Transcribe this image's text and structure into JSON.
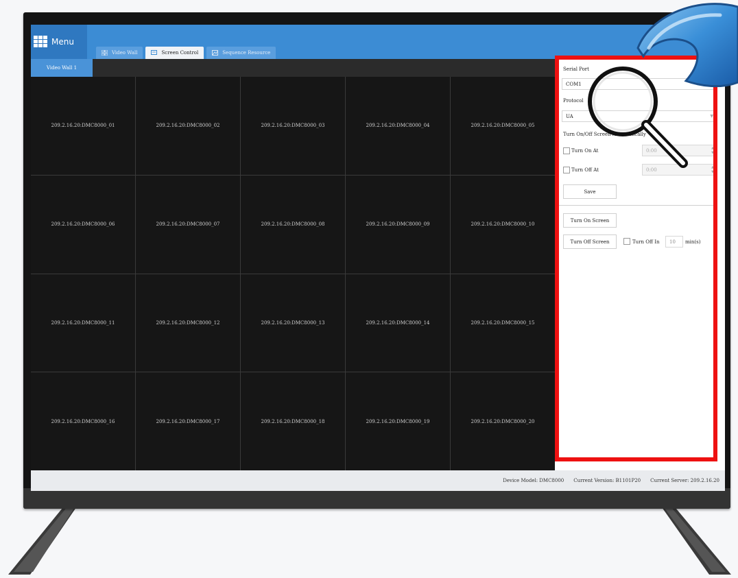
{
  "app": {
    "menu_label": "Menu",
    "tabs": [
      {
        "label": "Video Wall",
        "icon": "grid-icon",
        "active": false
      },
      {
        "label": "Screen Control",
        "icon": "screen-icon",
        "active": true
      },
      {
        "label": "Sequence Resource",
        "icon": "image-icon",
        "active": false
      }
    ],
    "subtab_label": "Video Wall 1"
  },
  "video_wall": {
    "cells": [
      "209.2.16.20:DMC8000_01",
      "209.2.16.20:DMC8000_02",
      "209.2.16.20:DMC8000_03",
      "209.2.16.20:DMC8000_04",
      "209.2.16.20:DMC8000_05",
      "209.2.16.20:DMC8000_06",
      "209.2.16.20:DMC8000_07",
      "209.2.16.20:DMC8000_08",
      "209.2.16.20:DMC8000_09",
      "209.2.16.20:DMC8000_10",
      "209.2.16.20:DMC8000_11",
      "209.2.16.20:DMC8000_12",
      "209.2.16.20:DMC8000_13",
      "209.2.16.20:DMC8000_14",
      "209.2.16.20:DMC8000_15",
      "209.2.16.20:DMC8000_16",
      "209.2.16.20:DMC8000_17",
      "209.2.16.20:DMC8000_18",
      "209.2.16.20:DMC8000_19",
      "209.2.16.20:DMC8000_20"
    ]
  },
  "panel": {
    "serial_port_label": "Serial Port",
    "serial_port_value": "COM1",
    "protocol_label": "Protocol",
    "protocol_value": "UA",
    "auto_label": "Turn On/Off Screen Automatically",
    "turn_on_at_label": "Turn On At",
    "turn_on_at_value": "0:00",
    "turn_off_at_label": "Turn Off At",
    "turn_off_at_value": "0:00",
    "save_label": "Save",
    "turn_on_screen_label": "Turn On Screen",
    "turn_off_screen_label": "Turn Off Screen",
    "turn_off_in_label": "Turn Off In",
    "turn_off_in_value": "10",
    "turn_off_in_unit": "min(s)"
  },
  "status": {
    "device_model": "Device Model: DMC8000",
    "current_version": "Current Version: B1101P20",
    "current_server": "Current Server: 209.2.16.20"
  },
  "colors": {
    "topbar": "#3c8cd4",
    "highlight_frame": "#ee1111",
    "cell_bg": "#161616"
  },
  "overlay_icon": "magnifier-icon"
}
